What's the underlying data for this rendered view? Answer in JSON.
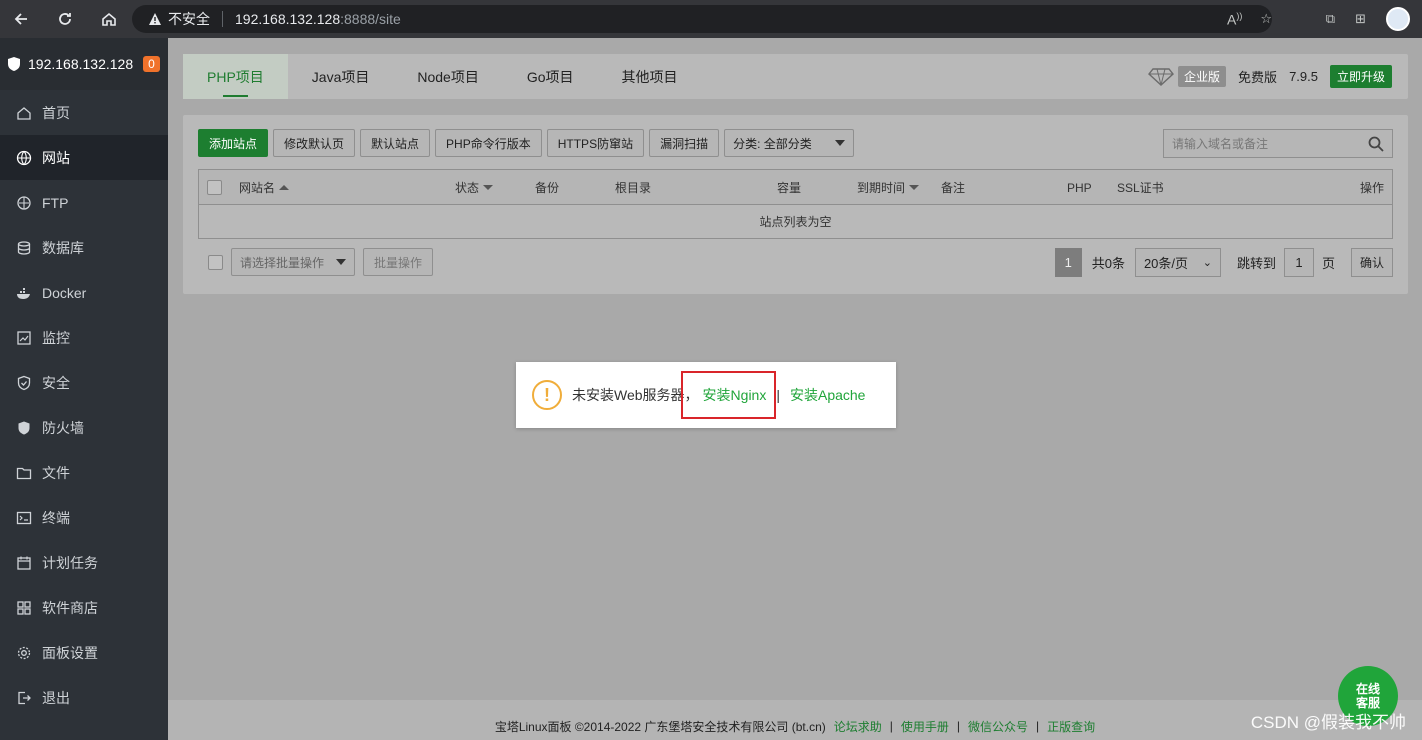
{
  "browser": {
    "security_label": "不安全",
    "host": "192.168.132.128",
    "path": ":8888/site"
  },
  "sidebar": {
    "server_ip": "192.168.132.128",
    "notice_count": "0",
    "items": [
      {
        "label": "首页",
        "icon": "home-icon"
      },
      {
        "label": "网站",
        "icon": "globe-icon"
      },
      {
        "label": "FTP",
        "icon": "ftp-icon"
      },
      {
        "label": "数据库",
        "icon": "database-icon"
      },
      {
        "label": "Docker",
        "icon": "docker-icon"
      },
      {
        "label": "监控",
        "icon": "monitor-icon"
      },
      {
        "label": "安全",
        "icon": "shield-icon"
      },
      {
        "label": "防火墙",
        "icon": "firewall-icon"
      },
      {
        "label": "文件",
        "icon": "folder-icon"
      },
      {
        "label": "终端",
        "icon": "terminal-icon"
      },
      {
        "label": "计划任务",
        "icon": "calendar-icon"
      },
      {
        "label": "软件商店",
        "icon": "apps-icon"
      },
      {
        "label": "面板设置",
        "icon": "gear-icon"
      },
      {
        "label": "退出",
        "icon": "logout-icon"
      }
    ],
    "active_index": 1
  },
  "tabs": [
    "PHP项目",
    "Java项目",
    "Node项目",
    "Go项目",
    "其他项目"
  ],
  "edition": {
    "enterprise_label": "企业版",
    "free_label": "免费版",
    "version": "7.9.5",
    "upgrade_label": "立即升级"
  },
  "toolbar": {
    "add_site": "添加站点",
    "edit_default_page": "修改默认页",
    "default_site": "默认站点",
    "php_cli_version": "PHP命令行版本",
    "https_protect": "HTTPS防窜站",
    "vuln_scan": "漏洞扫描",
    "category_select": "分类: 全部分类",
    "search_placeholder": "请输入域名或备注"
  },
  "table": {
    "headers": {
      "site_name": "网站名",
      "status": "状态",
      "backup": "备份",
      "root_dir": "根目录",
      "capacity": "容量",
      "expire": "到期时间",
      "remark": "备注",
      "php": "PHP",
      "ssl": "SSL证书",
      "action": "操作"
    },
    "empty_text": "站点列表为空"
  },
  "batch": {
    "select_placeholder": "请选择批量操作",
    "button": "批量操作"
  },
  "pager": {
    "current_page": "1",
    "total": "共0条",
    "per_page": "20条/页",
    "jump_label": "跳转到",
    "jump_value": "1",
    "page_unit": "页",
    "confirm": "确认"
  },
  "dialog": {
    "message": "未安装Web服务器，",
    "install_nginx": "安装Nginx",
    "separator": "|",
    "install_apache": "安装Apache"
  },
  "footer": {
    "copyright": "宝塔Linux面板 ©2014-2022 广东堡塔安全技术有限公司 (bt.cn)",
    "links": [
      "论坛求助",
      "使用手册",
      "微信公众号",
      "正版查询"
    ]
  },
  "chat_button": {
    "line1": "在线",
    "line2": "客服"
  },
  "watermark": "CSDN @假装我不帅"
}
